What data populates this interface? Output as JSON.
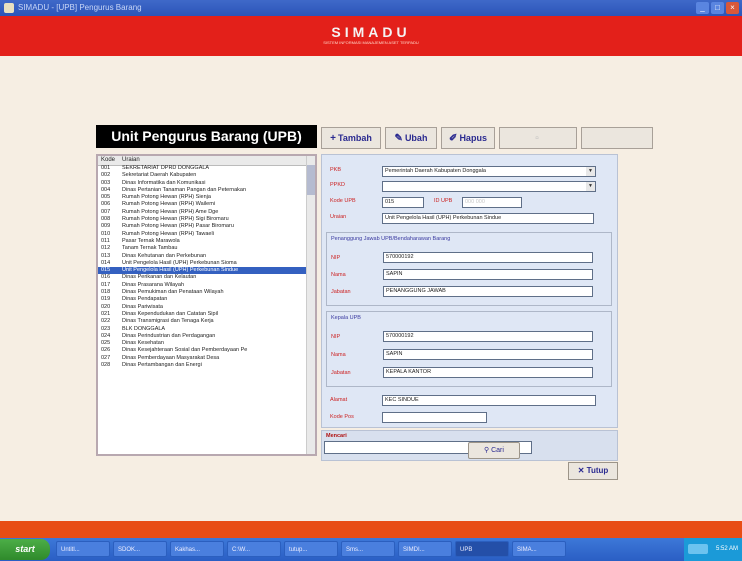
{
  "window": {
    "title": "SIMADU - [UPB] Pengurus Barang",
    "controls": [
      "_",
      "□",
      "×"
    ]
  },
  "banner": {
    "brand": "SIMADU",
    "subtitle": "SISTEM INFORMASI MANAJEMEN ASET TERPADU"
  },
  "form": {
    "title": "Unit Pengurus Barang (UPB)"
  },
  "toolbar": {
    "tambah": "Tambah",
    "ubah": "Ubah",
    "hapus": "Hapus",
    "simpan": "",
    "batal": ""
  },
  "list": {
    "col_kode": "Kode",
    "col_uraian": "Uraian",
    "selected_index": 14,
    "rows": [
      {
        "kode": "001",
        "uraian": "SEKRETARIAT DPRD DONGGALA"
      },
      {
        "kode": "002",
        "uraian": "Sekretariat Daerah Kabupaten"
      },
      {
        "kode": "003",
        "uraian": "Dinas Informatika dan Komunikasi"
      },
      {
        "kode": "004",
        "uraian": "Dinas Pertanian Tanaman Pangan dan Peternakan"
      },
      {
        "kode": "005",
        "uraian": "Rumah Potong Hewan (RPH) Sienja"
      },
      {
        "kode": "006",
        "uraian": "Rumah Potong Hewan (RPH) Wailemi"
      },
      {
        "kode": "007",
        "uraian": "Rumah Potong Hewan (RPH) Ame Dge"
      },
      {
        "kode": "008",
        "uraian": "Rumah Potong Hewan (RPH) Sigi Biromaru"
      },
      {
        "kode": "009",
        "uraian": "Rumah Potong Hewan (RPH) Pasar Biromaru"
      },
      {
        "kode": "010",
        "uraian": "Rumah Potong Hewan (RPH) Tawaeli"
      },
      {
        "kode": "011",
        "uraian": "Pasar Ternak Marawola"
      },
      {
        "kode": "012",
        "uraian": "Tanam Ternak Tambau"
      },
      {
        "kode": "013",
        "uraian": "Dinas Kehutanan dan Perkebunan"
      },
      {
        "kode": "014",
        "uraian": "Unit Pengelola Hasil (UPH) Perkebunan Sioma"
      },
      {
        "kode": "015",
        "uraian": "Unit Pengelola Hasil (UPH) Perkebunan Sindue"
      },
      {
        "kode": "016",
        "uraian": "Dinas Perikanan dan Kelautan"
      },
      {
        "kode": "017",
        "uraian": "Dinas Prasarana Wilayah"
      },
      {
        "kode": "018",
        "uraian": "Dinas Pemukiman dan Penataan Wilayah"
      },
      {
        "kode": "019",
        "uraian": "Dinas Pendapatan"
      },
      {
        "kode": "020",
        "uraian": "Dinas Pariwisata"
      },
      {
        "kode": "021",
        "uraian": "Dinas Kependudukan dan Catatan Sipil"
      },
      {
        "kode": "022",
        "uraian": "Dinas Transmigrasi dan Tenaga Kerja"
      },
      {
        "kode": "023",
        "uraian": "BLK DONGGALA"
      },
      {
        "kode": "024",
        "uraian": "Dinas Perindustrian dan Perdagangan"
      },
      {
        "kode": "025",
        "uraian": "Dinas Kesehatan"
      },
      {
        "kode": "026",
        "uraian": "Dinas Kesejahteraan Sosial dan Pemberdayaan Pe"
      },
      {
        "kode": "027",
        "uraian": "Dinas Pemberdayaan Masyarakat Desa"
      },
      {
        "kode": "028",
        "uraian": "Dinas Pertambangan dan Energi"
      }
    ]
  },
  "detail": {
    "pkb_label": "PKB",
    "pkb_value": "Pemerintah Daerah Kabupaten Donggala",
    "ppkd_label": "PPKD",
    "ppkd_value": "",
    "kode_label": "Kode UPB",
    "kode_value": "015",
    "id_label": "ID UPB",
    "id_value": "000 000",
    "uraian_label": "Uraian",
    "uraian_value": "Unit Pengelola Hasil (UPH) Perkebunan Sindue",
    "pj_title": "Penanggung Jawab UPB/Bendaharawan Barang",
    "pj_nip_label": "NIP",
    "pj_nip_value": "570000192",
    "pj_nama_label": "Nama",
    "pj_nama_value": "SAPIN",
    "pj_jabatan_label": "Jabatan",
    "pj_jabatan_value": "PENANGGUNG JAWAB",
    "kepala_title": "Kepala UPB",
    "kp_nip_label": "NIP",
    "kp_nip_value": "570000192",
    "kp_nama_label": "Nama",
    "kp_nama_value": "SAPIN",
    "kp_jabatan_label": "Jabatan",
    "kp_jabatan_value": "KEPALA KANTOR",
    "alamat_label": "Alamat",
    "alamat_value": "KEC SINDUE",
    "kodepos_label": "Kode Pos",
    "kodepos_value": ""
  },
  "search": {
    "label": "Mencari",
    "value": "",
    "button": "Cari"
  },
  "close_button": "Tutup",
  "taskbar": {
    "start": "start",
    "buttons": [
      "Untitl...",
      "SDOK...",
      "Kakhas...",
      "C:\\W...",
      "tutup...",
      "Sms...",
      "SIMDI...",
      "UPB",
      "SIMA..."
    ],
    "active_index": 7,
    "clock": "5:52 AM"
  }
}
